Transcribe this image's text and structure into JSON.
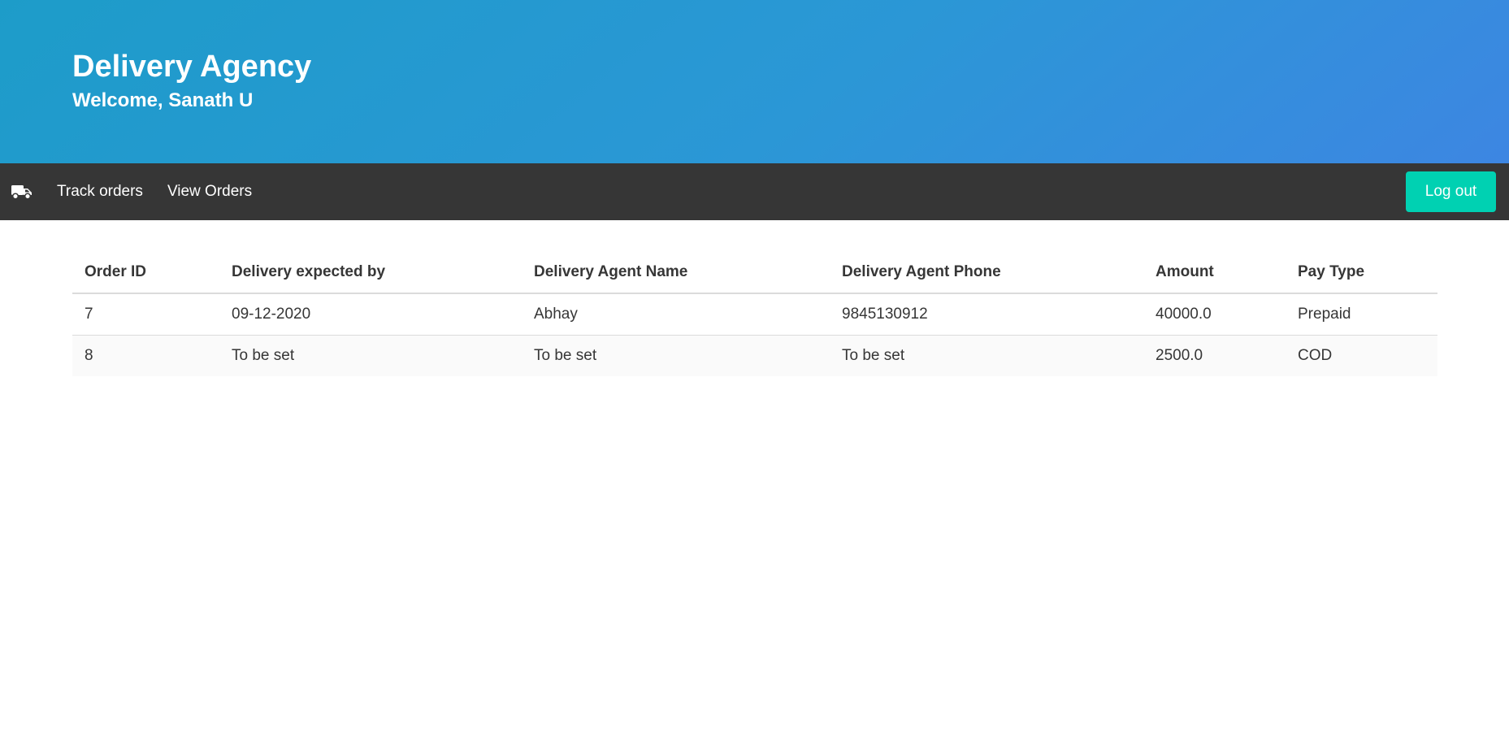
{
  "header": {
    "title": "Delivery Agency",
    "subtitle": "Welcome, Sanath U"
  },
  "nav": {
    "brand_icon": "truck-icon",
    "links": [
      "Track orders",
      "View Orders"
    ],
    "logout_label": "Log out"
  },
  "colors": {
    "hero_start": "#1d9cc9",
    "hero_end": "#3d86e2",
    "navbar": "#363636",
    "logout": "#00d1b2"
  },
  "orders": {
    "columns": [
      "Order ID",
      "Delivery expected by",
      "Delivery Agent Name",
      "Delivery Agent Phone",
      "Amount",
      "Pay Type"
    ],
    "rows": [
      [
        "7",
        "09-12-2020",
        "Abhay",
        "9845130912",
        "40000.0",
        "Prepaid"
      ],
      [
        "8",
        "To be set",
        "To be set",
        "To be set",
        "2500.0",
        "COD"
      ]
    ]
  }
}
